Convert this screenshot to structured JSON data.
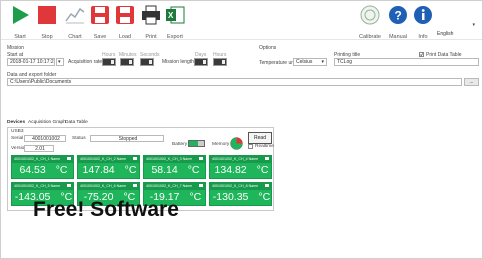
{
  "toolbar": {
    "start": "Start",
    "stop": "Stop",
    "chart": "Chart",
    "save": "Save",
    "load": "Load",
    "print": "Print",
    "export": "Export",
    "calibrate": "Calibrate",
    "manual": "Manual",
    "info": "Info",
    "language": "English"
  },
  "mission": {
    "section": "Mission",
    "start_at_label": "Start at",
    "start_at_value": "2018-01-17 10:17:22",
    "acq_rate_label": "Acquisition rate",
    "col_hours": "Hours",
    "col_minutes": "Minutes",
    "col_seconds": "Seconds",
    "mission_length_label": "Mission length",
    "col_days": "Days",
    "col_hours2": "Hours"
  },
  "options": {
    "section": "Options",
    "temp_unit_label": "Temperature unit",
    "temp_unit_value": "Celsius",
    "printing_title_label": "Printing title",
    "printing_title_value": "TCLog",
    "print_data_table": "Print Data Table"
  },
  "export_folder": {
    "label": "Data and export folder",
    "value": "C:\\Users\\Public\\Documents",
    "browse": "..."
  },
  "tabs": [
    "Devices",
    "Acquisition Graph",
    "Data Table"
  ],
  "device": {
    "group": "USB3",
    "serial_label": "Serial",
    "serial_value": "4001001002",
    "status_label": "Status",
    "status_value": "Stopped",
    "version_label": "Version",
    "version_value": "2.01",
    "battery_label": "Battery",
    "memory_label": "Memory",
    "read_button": "Read",
    "realtime": "Realtime"
  },
  "channels": [
    {
      "name": "4001001002_K_CH_1 Name",
      "value": "64.53",
      "unit": "°C"
    },
    {
      "name": "4001001002_K_CH_2 Name",
      "value": "147.84",
      "unit": "°C"
    },
    {
      "name": "4001001002_K_CH_3 Name",
      "value": "58.14",
      "unit": "°C"
    },
    {
      "name": "4001001002_K_CH_4 Name",
      "value": "134.82",
      "unit": "°C"
    },
    {
      "name": "4001001002_K_CH_5 Name",
      "value": "-143.05",
      "unit": "°C"
    },
    {
      "name": "4001001002_K_CH_6 Name",
      "value": "-75.20",
      "unit": "°C"
    },
    {
      "name": "4001001002_K_CH_7 Name",
      "value": "-19.17",
      "unit": "°C"
    },
    {
      "name": "4001001002_K_CH_8 Name",
      "value": "-130.35",
      "unit": "°C"
    }
  ],
  "promo": "Free! Software",
  "colors": {
    "tile_green": "#1fb55a",
    "start_green": "#1e9e4a",
    "stop_red": "#e0373a"
  }
}
